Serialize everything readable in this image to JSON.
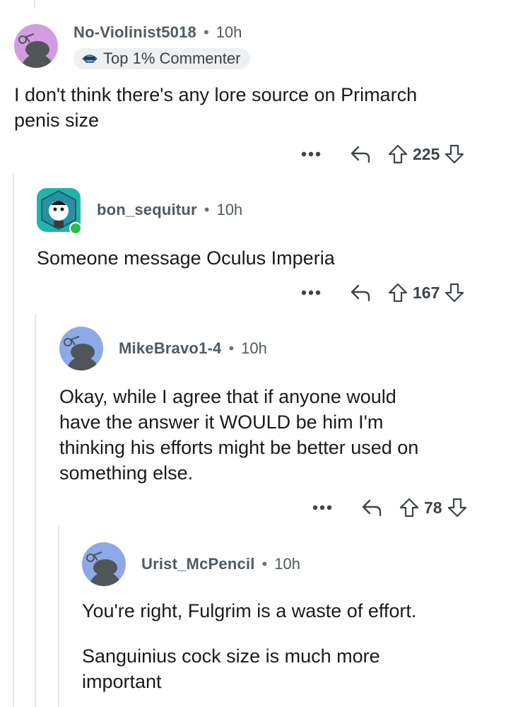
{
  "comments": [
    {
      "username": "No-Violinist5018",
      "time": "10h",
      "flair": "Top 1% Commenter",
      "body": [
        "I don't think there's any lore source on Primarch",
        "penis size"
      ],
      "votes": "225",
      "avatar_color": "#d39ce0"
    },
    {
      "username": "bon_sequitur",
      "time": "10h",
      "body": [
        "Someone message Oculus Imperia"
      ],
      "votes": "167",
      "avatar_color": "#1fb5a8"
    },
    {
      "username": "MikeBravo1-4",
      "time": "10h",
      "body": [
        "Okay, while I agree that if anyone would",
        "have the answer it WOULD be him I'm",
        "thinking his efforts might be better used on",
        "something else."
      ],
      "votes": "78",
      "avatar_color": "#8ea9e8"
    },
    {
      "username": "Urist_McPencil",
      "time": "10h",
      "body": [
        "You're right, Fulgrim is a waste of effort.",
        "Sanguinius cock size is much more",
        "important"
      ],
      "avatar_color": "#8ea9e8"
    }
  ],
  "separator": "•",
  "icons": {
    "more": "more-options-icon",
    "reply": "reply-icon",
    "upvote": "upvote-icon",
    "downvote": "downvote-icon"
  }
}
